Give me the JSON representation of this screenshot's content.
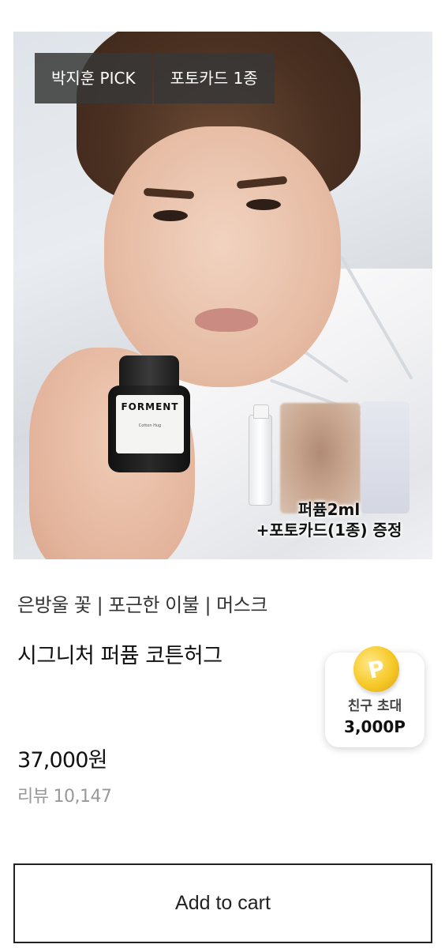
{
  "product_image": {
    "tags": [
      "박지훈 PICK",
      "포토카드 1종"
    ],
    "bottle_brand": "FORMENT",
    "bottle_sub": "Cotton Hug",
    "gift_line1": "퍼퓸2ml",
    "gift_line2": "+포토카드(1종) 증정"
  },
  "product": {
    "notes": "은방울 꽃 | 포근한 이불 | 머스크",
    "name": "시그니처 퍼퓸 코튼허그",
    "price": "37,000원",
    "review_label": "리뷰",
    "review_count": "10,147"
  },
  "invite": {
    "coin_symbol": "P",
    "label": "친구 초대",
    "points": "3,000P"
  },
  "cart": {
    "label": "Add to cart"
  },
  "colors": {
    "tag_bg": "#373737",
    "coin": "#f6c928",
    "border": "#222222"
  }
}
